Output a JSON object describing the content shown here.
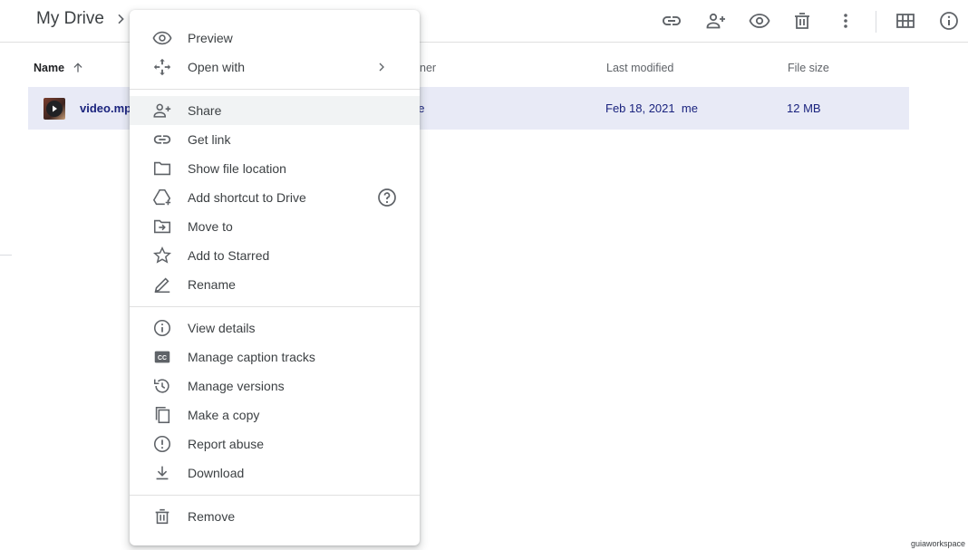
{
  "breadcrumb": {
    "title": "My Drive"
  },
  "toolbar": {
    "icons": [
      "link-icon",
      "add-person-icon",
      "preview-eye-icon",
      "trash-icon",
      "more-vert-icon",
      "grid-view-icon",
      "info-icon"
    ]
  },
  "columns": {
    "name": "Name",
    "owner": "Owner",
    "owner_visible": "wner",
    "modified": "Last modified",
    "size": "File size"
  },
  "file": {
    "name_visible": "video.mp",
    "owner_visible": "ne",
    "modified": "Feb 18, 2021",
    "modified_by": "me",
    "size": "12 MB"
  },
  "menu": {
    "preview": "Preview",
    "open_with": "Open with",
    "share": "Share",
    "get_link": "Get link",
    "show_file_location": "Show file location",
    "add_shortcut": "Add shortcut to Drive",
    "move_to": "Move to",
    "add_starred": "Add to Starred",
    "rename": "Rename",
    "view_details": "View details",
    "manage_captions": "Manage caption tracks",
    "manage_versions": "Manage versions",
    "make_copy": "Make a copy",
    "report_abuse": "Report abuse",
    "download": "Download",
    "remove": "Remove"
  },
  "watermark": "guiaworkspace",
  "colors": {
    "selected_row": "#e8eaf6",
    "hover_item": "#f1f3f4",
    "text": "#3c4043",
    "icon": "#5f6368"
  }
}
